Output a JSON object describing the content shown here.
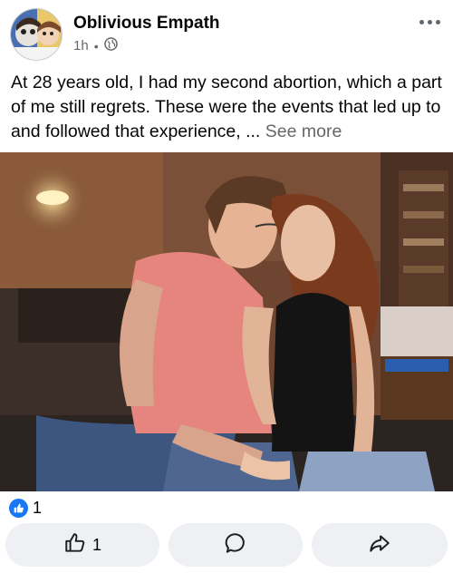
{
  "post": {
    "author": "Oblivious Empath",
    "time": "1h",
    "separator": "•",
    "privacy_icon": "globe-icon",
    "text": "At 28 years old, I had my second abortion, which a part of me still regrets. These were the events that led up to and followed that experience, ...",
    "see_more": "See more"
  },
  "reactions": {
    "icon": "like-badge-icon",
    "count": "1"
  },
  "actions": {
    "like_count": "1"
  },
  "colors": {
    "accent": "#1877f2",
    "muted": "#65676b",
    "button_bg": "#eff0f3"
  }
}
